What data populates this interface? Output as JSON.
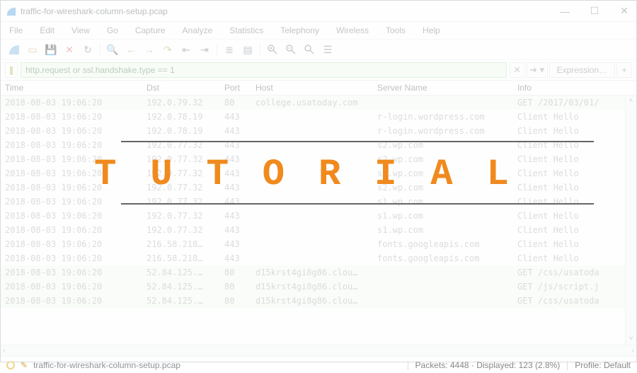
{
  "title": "traffic-for-wireshark-column-setup.pcap",
  "menus": [
    "File",
    "Edit",
    "View",
    "Go",
    "Capture",
    "Analyze",
    "Statistics",
    "Telephony",
    "Wireless",
    "Tools",
    "Help"
  ],
  "toolbar_icons": [
    "filelist",
    "folder-open",
    "floppy",
    "close-x",
    "magnify",
    "restart",
    "stop",
    "back-arrow1",
    "fwd-arrow1",
    "jump-left",
    "jump-right",
    "sep",
    "line",
    "line",
    "sep",
    "columns",
    "plus",
    "minus",
    "resize",
    "sep",
    "zoom-in",
    "zoom-out",
    "zoom-reset",
    "bars"
  ],
  "filter": {
    "text": "http.request or ssl.handshake.type == 1",
    "expression_label": "Expression…"
  },
  "columns": [
    "Time",
    "Dst",
    "Port",
    "Host",
    "Server Name",
    "Info"
  ],
  "rows": [
    {
      "hl": true,
      "time": "2018-08-03 19:06:20",
      "dst": "192.0.79.32",
      "port": "80",
      "host": "college.usatoday.com",
      "sn": "",
      "info": "GET /2017/03/01/"
    },
    {
      "hl": false,
      "time": "2018-08-03 19:06:20",
      "dst": "192.0.78.19",
      "port": "443",
      "host": "",
      "sn": "r-login.wordpress.com",
      "info": "Client Hello"
    },
    {
      "hl": false,
      "time": "2018-08-03 19:06:20",
      "dst": "192.0.78.19",
      "port": "443",
      "host": "",
      "sn": "r-login.wordpress.com",
      "info": "Client Hello"
    },
    {
      "hl": false,
      "time": "2018-08-03 19:06:20",
      "dst": "192.0.77.32",
      "port": "443",
      "host": "",
      "sn": "s2.wp.com",
      "info": "Client Hello"
    },
    {
      "hl": false,
      "time": "2018-08-03 19:06:20",
      "dst": "192.0.77.32",
      "port": "443",
      "host": "",
      "sn": "s2.wp.com",
      "info": "Client Hello"
    },
    {
      "hl": false,
      "time": "2018-08-03 19:06:20",
      "dst": "192.0.77.32",
      "port": "443",
      "host": "",
      "sn": "s2.wp.com",
      "info": "Client Hello"
    },
    {
      "hl": false,
      "time": "2018-08-03 19:06:20",
      "dst": "192.0.77.32",
      "port": "443",
      "host": "",
      "sn": "s2.wp.com",
      "info": "Client Hello"
    },
    {
      "hl": false,
      "time": "2018-08-03 19:06:20",
      "dst": "192.0.77.32",
      "port": "443",
      "host": "",
      "sn": "s1.wp.com",
      "info": "Client Hello"
    },
    {
      "hl": false,
      "time": "2018-08-03 19:06:20",
      "dst": "192.0.77.32",
      "port": "443",
      "host": "",
      "sn": "s1.wp.com",
      "info": "Client Hello"
    },
    {
      "hl": false,
      "time": "2018-08-03 19:06:20",
      "dst": "192.0.77.32",
      "port": "443",
      "host": "",
      "sn": "s1.wp.com",
      "info": "Client Hello"
    },
    {
      "hl": false,
      "time": "2018-08-03 19:06:20",
      "dst": "216.58.218…",
      "port": "443",
      "host": "",
      "sn": "fonts.googleapis.com",
      "info": "Client Hello"
    },
    {
      "hl": false,
      "time": "2018-08-03 19:06:20",
      "dst": "216.58.218…",
      "port": "443",
      "host": "",
      "sn": "fonts.googleapis.com",
      "info": "Client Hello"
    },
    {
      "hl": true,
      "time": "2018-08-03 19:06:20",
      "dst": "52.84.125.…",
      "port": "80",
      "host": "d15krst4gi8g86.clou…",
      "sn": "",
      "info": "GET /css/usatoda"
    },
    {
      "hl": true,
      "time": "2018-08-03 19:06:20",
      "dst": "52.84.125.…",
      "port": "80",
      "host": "d15krst4gi8g86.clou…",
      "sn": "",
      "info": "GET /js/script.j"
    },
    {
      "hl": true,
      "time": "2018-08-03 19:06:20",
      "dst": "52.84.125.…",
      "port": "80",
      "host": "d15krst4gi8g86.clou…",
      "sn": "",
      "info": "GET /css/usatoda"
    }
  ],
  "status": {
    "file": "traffic-for-wireshark-column-setup.pcap",
    "packets": "Packets: 4448 · Displayed: 123 (2.8%)",
    "profile": "Profile: Default"
  },
  "overlay_text": "TUTORIAL"
}
